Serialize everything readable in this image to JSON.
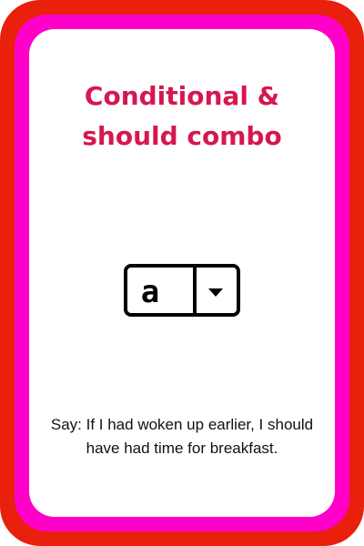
{
  "card": {
    "title_line1": "Conditional &",
    "title_line2": "should combo",
    "dropdown_value": "a",
    "caption": "Say: If I had woken up earlier, I should have had time for breakfast."
  },
  "colors": {
    "outer_frame": "#e8200c",
    "inner_frame": "#ff00c8",
    "title": "#d6174f",
    "text": "#111111"
  },
  "icons": {
    "dropdown_arrow": "chevron-down-icon"
  }
}
